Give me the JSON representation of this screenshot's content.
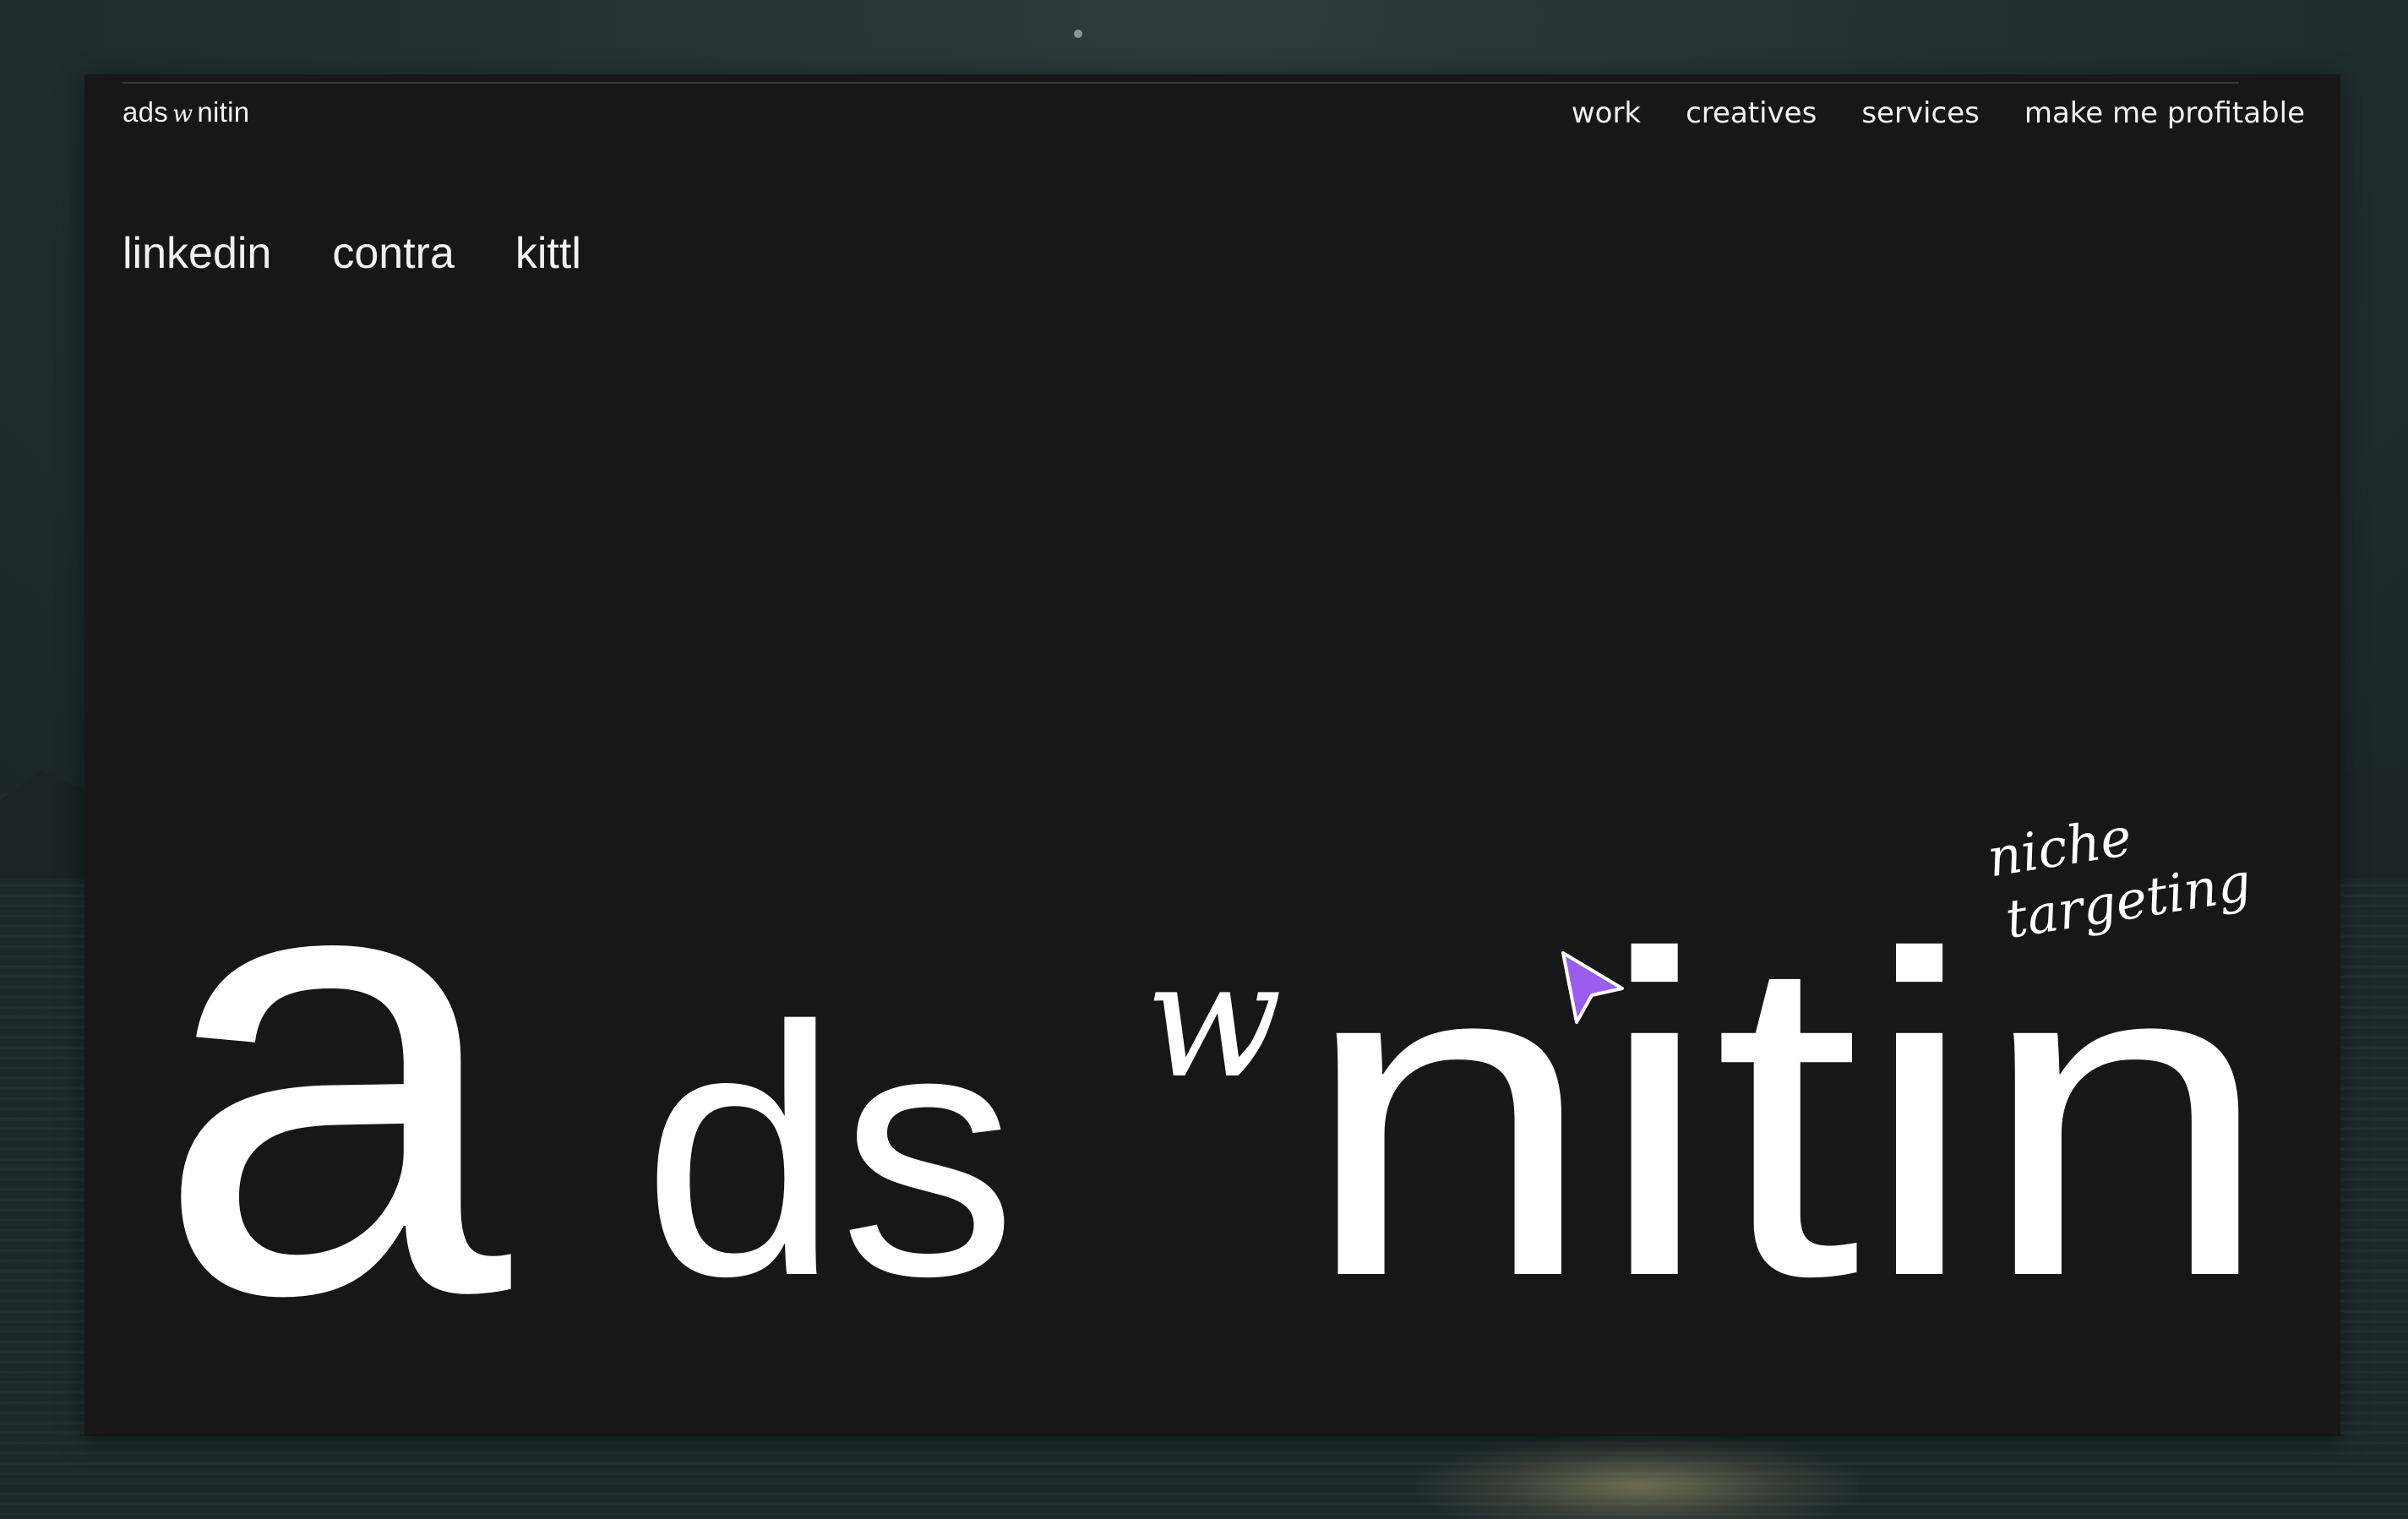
{
  "site": {
    "brand": {
      "first": "ads",
      "mid": "w",
      "last": "nitin"
    },
    "nav": [
      {
        "label": "work"
      },
      {
        "label": "creatives"
      },
      {
        "label": "services"
      },
      {
        "label": "make me profitable"
      }
    ],
    "social_links": [
      {
        "label": "linkedin"
      },
      {
        "label": "contra"
      },
      {
        "label": "kittl"
      }
    ],
    "hero": {
      "big_a": "a",
      "ds": "ds",
      "script_w": "w",
      "nitin": "nitin",
      "annotation_line1": "niche",
      "annotation_line2": "targeting"
    }
  },
  "colors": {
    "background": "#171717",
    "text": "#ffffff",
    "cursor": "#9b5cf0"
  },
  "icons": {
    "cursor": "arrow-cursor-icon"
  }
}
